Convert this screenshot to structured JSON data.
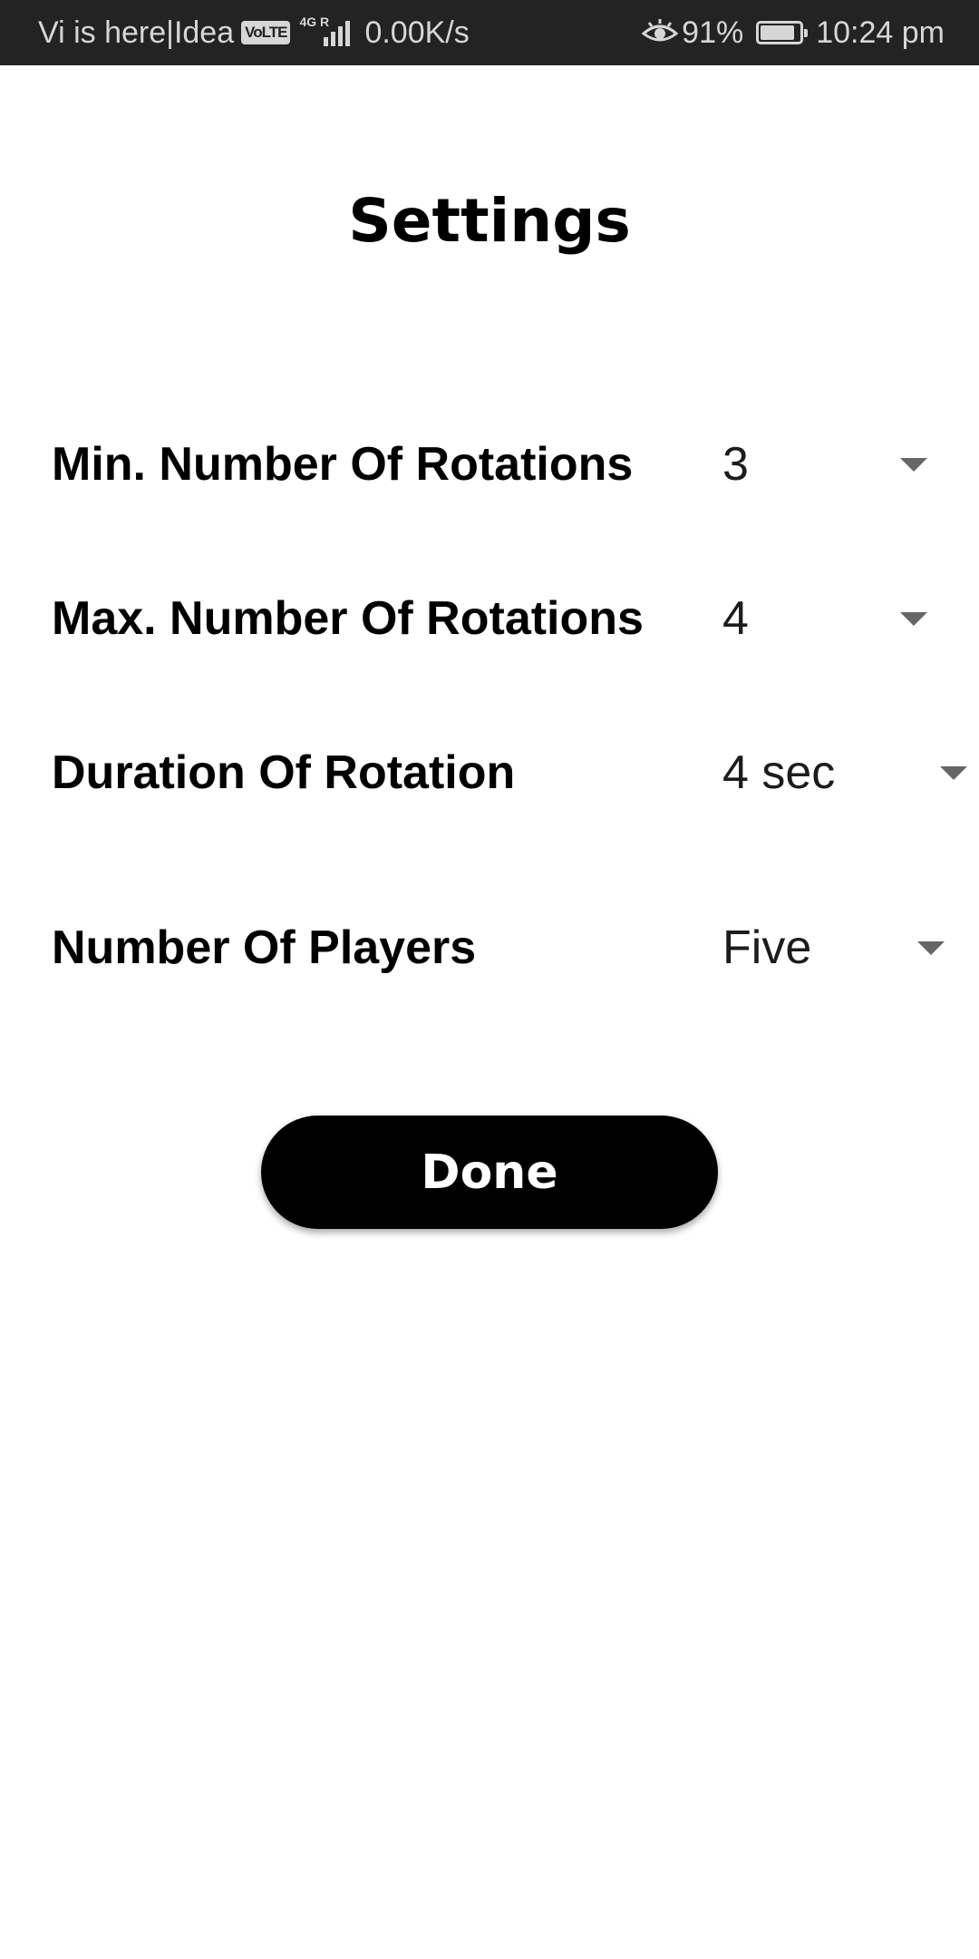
{
  "status_bar": {
    "carrier": "Vi is here|Idea",
    "volte": "VoLTE",
    "network": "4G R",
    "speed": "0.00K/s",
    "eye_icon": "eye-comfort-icon",
    "battery_percent": "91%",
    "battery_level": 0.91,
    "time": "10:24 pm"
  },
  "title": "Settings",
  "settings": [
    {
      "label": "Min. Number Of Rotations",
      "value": "3"
    },
    {
      "label": "Max. Number Of Rotations",
      "value": "4"
    },
    {
      "label": "Duration Of Rotation",
      "value": "4 sec"
    },
    {
      "label": "Number Of Players",
      "value": "Five"
    }
  ],
  "done_label": "Done",
  "colors": {
    "status_bar_bg": "#232323",
    "button_bg": "#000000",
    "button_text": "#ffffff",
    "caret": "#666666"
  }
}
